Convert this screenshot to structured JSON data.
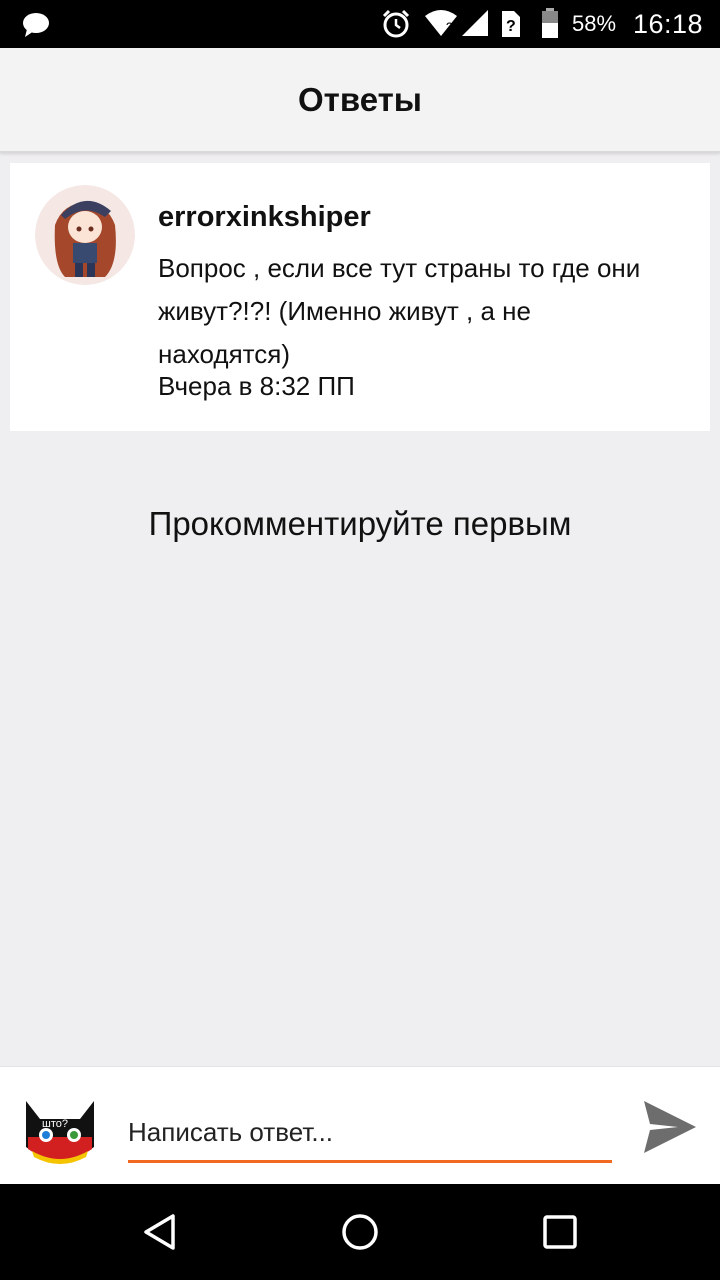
{
  "status_bar": {
    "battery_percent": "58%",
    "time": "16:18",
    "icons": [
      "chat-icon",
      "alarm-icon",
      "wifi-icon",
      "signal-icon",
      "sim-unknown-icon",
      "battery-icon"
    ]
  },
  "header": {
    "title": "Ответы"
  },
  "post": {
    "username": "errorxinkshiper",
    "text": "Вопрос , если все тут страны то где они живут?!?! (Именно живут , а не находятся)",
    "time": "Вчера в 8:32 ПП"
  },
  "empty_state": "Прокомментируйте первым",
  "reply": {
    "placeholder": "Написать ответ...",
    "avatar_caption": "што?",
    "accent_color": "#f26a21"
  },
  "nav": {
    "icons": [
      "back-icon",
      "home-icon",
      "recents-icon"
    ]
  }
}
